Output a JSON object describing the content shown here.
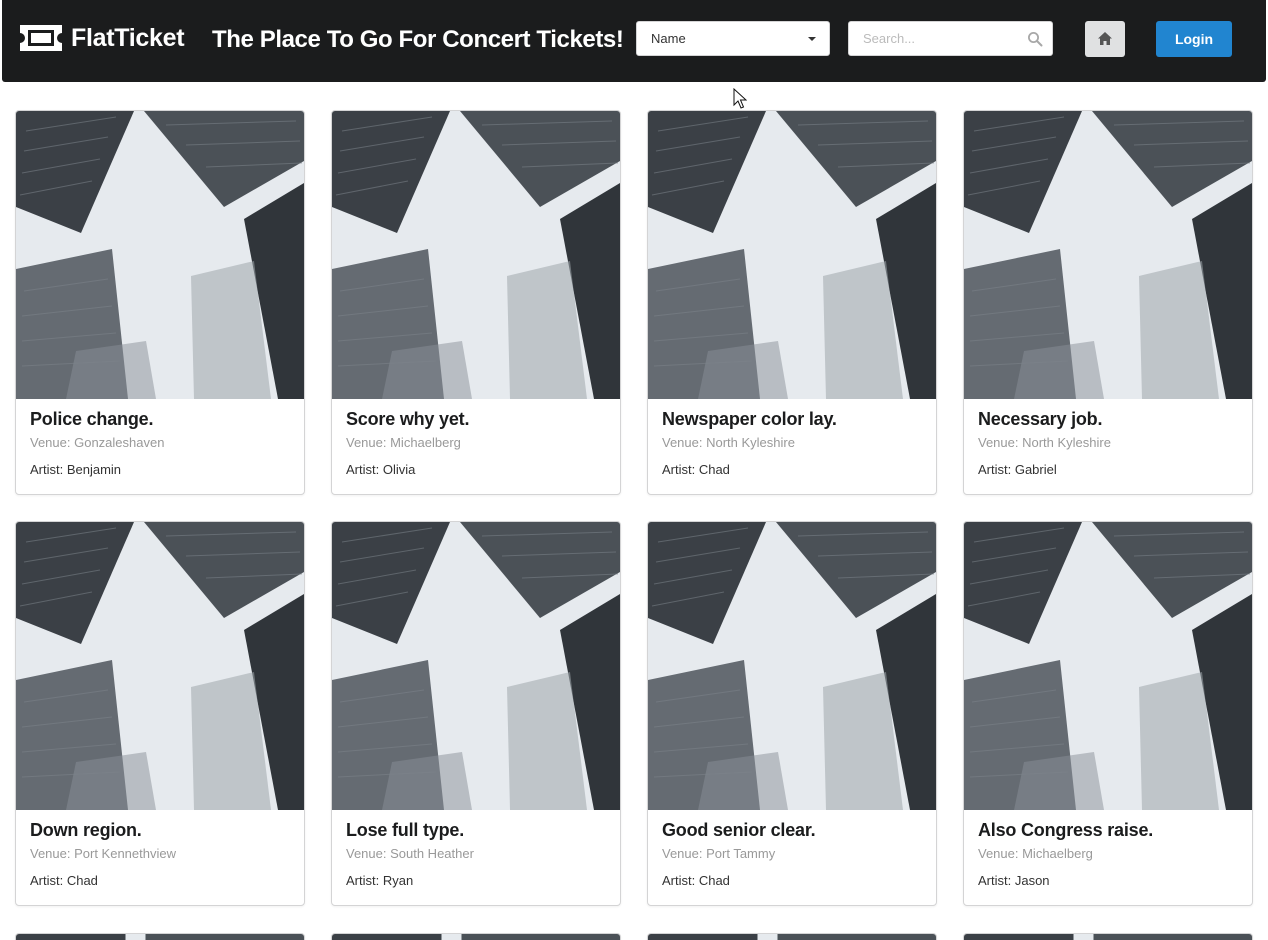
{
  "header": {
    "brand": "FlatTicket",
    "tagline": "The Place To Go For Concert Tickets!",
    "sort": {
      "selected": "Name"
    },
    "search": {
      "placeholder": "Search...",
      "value": ""
    },
    "login_label": "Login"
  },
  "icons": {
    "logo": "ticket-icon",
    "sort_caret": "caret-down-icon",
    "search": "search-icon",
    "home": "home-icon"
  },
  "colors": {
    "topbar": "#1b1c1d",
    "login_button": "#2185d0",
    "home_button": "#e0e1e2"
  },
  "events": [
    {
      "title": "Police change.",
      "venue": "Venue: Gonzaleshaven",
      "artist": "Artist: Benjamin"
    },
    {
      "title": "Score why yet.",
      "venue": "Venue: Michaelberg",
      "artist": "Artist: Olivia"
    },
    {
      "title": "Newspaper color lay.",
      "venue": "Venue: North Kyleshire",
      "artist": "Artist: Chad"
    },
    {
      "title": "Necessary job.",
      "venue": "Venue: North Kyleshire",
      "artist": "Artist: Gabriel"
    },
    {
      "title": "Down region.",
      "venue": "Venue: Port Kennethview",
      "artist": "Artist: Chad"
    },
    {
      "title": "Lose full type.",
      "venue": "Venue: South Heather",
      "artist": "Artist: Ryan"
    },
    {
      "title": "Good senior clear.",
      "venue": "Venue: Port Tammy",
      "artist": "Artist: Chad"
    },
    {
      "title": "Also Congress raise.",
      "venue": "Venue: Michaelberg",
      "artist": "Artist: Jason"
    }
  ]
}
